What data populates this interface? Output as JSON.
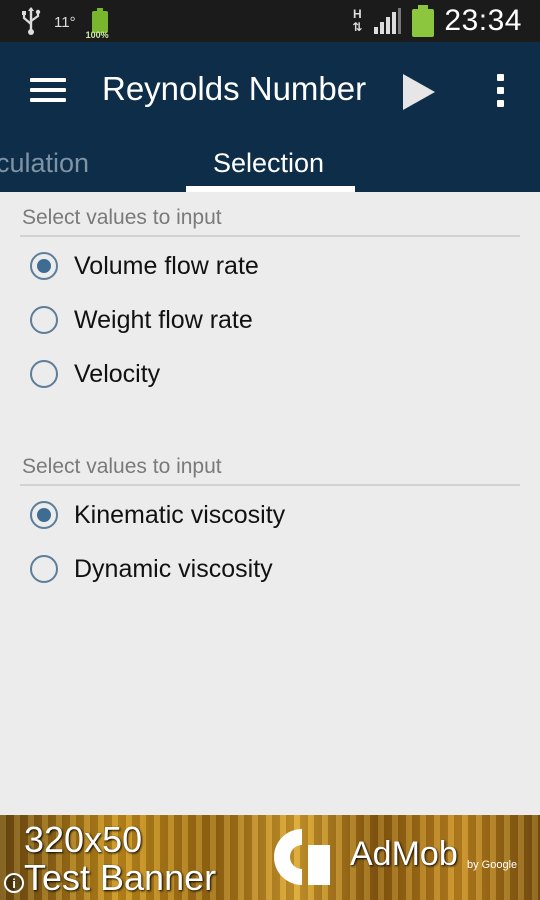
{
  "status_bar": {
    "temperature": "11°",
    "battery_small_text": "100%",
    "network_type": "H",
    "time": "23:34"
  },
  "action_bar": {
    "title": "Reynolds Number",
    "icons": [
      "menu-icon",
      "play-icon",
      "overflow-icon"
    ]
  },
  "tabs": [
    {
      "label": "Calculation",
      "visible_text": "lculation",
      "selected": false
    },
    {
      "label": "Selection",
      "selected": true
    }
  ],
  "sections": [
    {
      "header": "Select values to input",
      "options": [
        {
          "label": "Volume flow rate",
          "checked": true
        },
        {
          "label": "Weight flow rate",
          "checked": false
        },
        {
          "label": "Velocity",
          "checked": false
        }
      ]
    },
    {
      "header": "Select values to input",
      "options": [
        {
          "label": "Kinematic viscosity",
          "checked": true
        },
        {
          "label": "Dynamic viscosity",
          "checked": false
        }
      ]
    }
  ],
  "ad": {
    "line1": "320x50",
    "line2": "Test Banner",
    "brand": "AdMob",
    "by": "by Google"
  },
  "colors": {
    "action_bar": "#0d2d48",
    "status_bar": "#1b1b1b",
    "background": "#ececec",
    "radio_accent": "#3f6c93"
  }
}
